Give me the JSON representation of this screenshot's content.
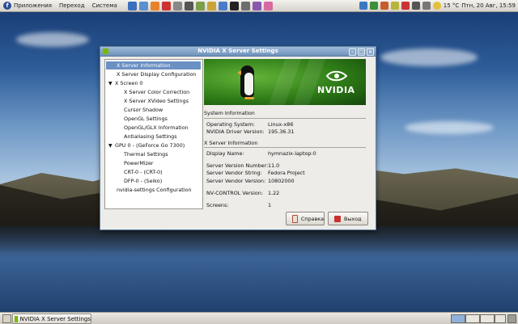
{
  "top_panel": {
    "menus": [
      "Приложения",
      "Переход",
      "Система"
    ],
    "temperature": "15 °C",
    "clock": "Птн, 20 Авг, 15:59"
  },
  "window": {
    "title": "NVIDIA X Server Settings",
    "banner_text": "NVIDIA",
    "tree": [
      {
        "label": "X Server Information",
        "level": 1,
        "selected": true
      },
      {
        "label": "X Server Display Configuration",
        "level": 1
      },
      {
        "label": "X Screen 0",
        "level": 0,
        "expanded": true
      },
      {
        "label": "X Server Color Correction",
        "level": 2
      },
      {
        "label": "X Server XVideo Settings",
        "level": 2
      },
      {
        "label": "Cursor Shadow",
        "level": 2
      },
      {
        "label": "OpenGL Settings",
        "level": 2
      },
      {
        "label": "OpenGL/GLX Information",
        "level": 2
      },
      {
        "label": "Antialiasing Settings",
        "level": 2
      },
      {
        "label": "GPU 0 - (GeForce Go 7300)",
        "level": 0,
        "expanded": true
      },
      {
        "label": "Thermal Settings",
        "level": 2
      },
      {
        "label": "PowerMizer",
        "level": 2
      },
      {
        "label": "CRT-0 - (CRT-0)",
        "level": 2
      },
      {
        "label": "DFP-0 - (Seiko)",
        "level": 2
      },
      {
        "label": "nvidia-settings Configuration",
        "level": 1
      }
    ],
    "system_info": {
      "heading": "System Information",
      "rows": [
        {
          "label": "Operating System:",
          "value": "Linux-x86"
        },
        {
          "label": "NVIDIA Driver Version:",
          "value": "195.36.31"
        }
      ]
    },
    "xserver_info": {
      "heading": "X Server Information",
      "rows": [
        {
          "label": "Display Name:",
          "value": "hymnazix-laptop:0"
        },
        {
          "label": "Server Version Number:",
          "value": "11.0"
        },
        {
          "label": "Server Vendor String:",
          "value": "Fedora Project"
        },
        {
          "label": "Server Vendor Version:",
          "value": "10802000"
        },
        {
          "label": "NV-CONTROL Version:",
          "value": "1.22"
        },
        {
          "label": "Screens:",
          "value": "1"
        }
      ]
    },
    "buttons": {
      "help": "Справка",
      "quit": "Выход"
    }
  },
  "taskbar": {
    "task_label": "NVIDIA X Server Settings"
  },
  "colors": {
    "nvidia_green": "#76b900",
    "selection": "#6b90c3",
    "titlebar": "#6f93bb"
  }
}
